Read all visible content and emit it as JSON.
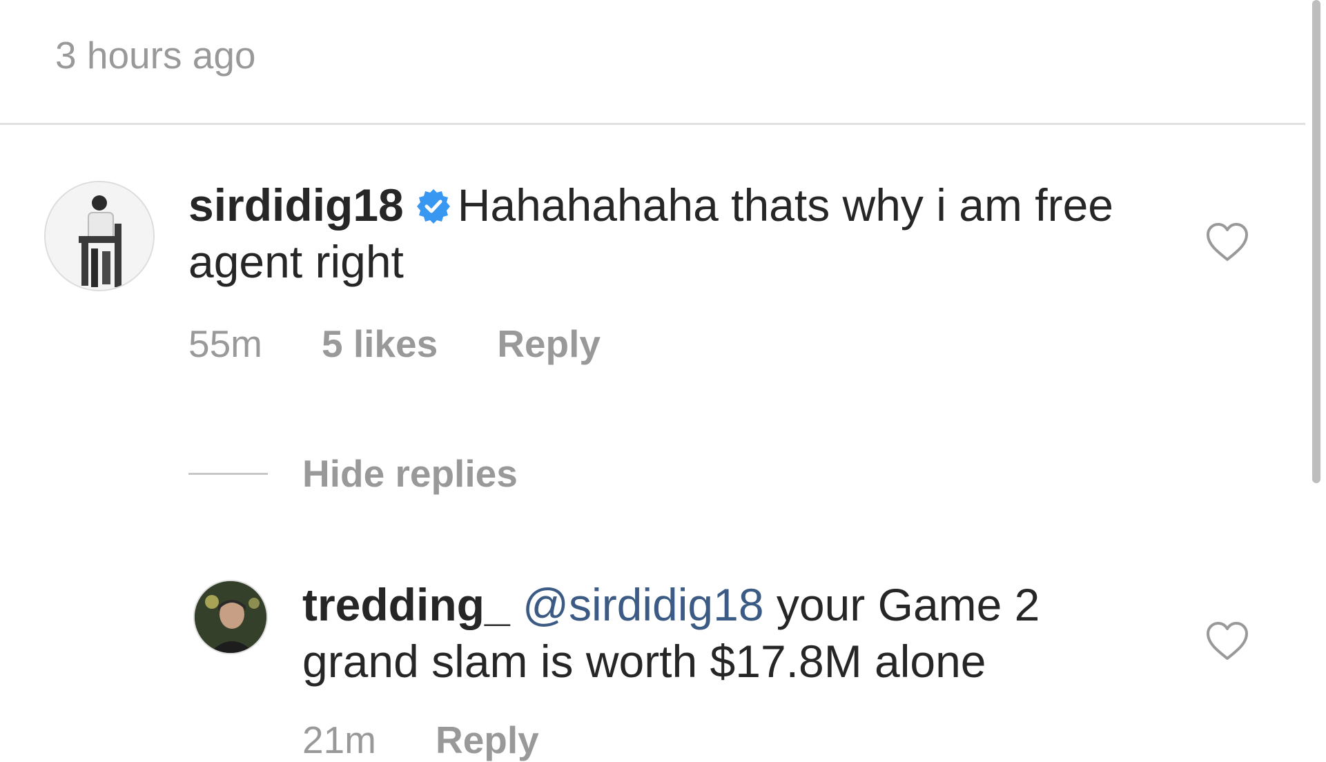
{
  "post": {
    "timestamp": "3 hours ago"
  },
  "comment": {
    "username": "sirdidig18",
    "verified": true,
    "text": "Hahahahaha thats why i am free agent right",
    "time": "55m",
    "likes": "5 likes",
    "reply_label": "Reply",
    "heart_icon": "heart-outline-icon"
  },
  "replies_toggle": {
    "label": "Hide replies"
  },
  "reply": {
    "username": "tredding_",
    "mention": "@sirdidig18",
    "text": "your Game 2 grand slam is worth $17.8M alone",
    "time": "21m",
    "reply_label": "Reply",
    "heart_icon": "heart-outline-icon"
  },
  "colors": {
    "verified_blue": "#3897f0",
    "mention_blue": "#3b5b85",
    "muted_gray": "#999999"
  }
}
